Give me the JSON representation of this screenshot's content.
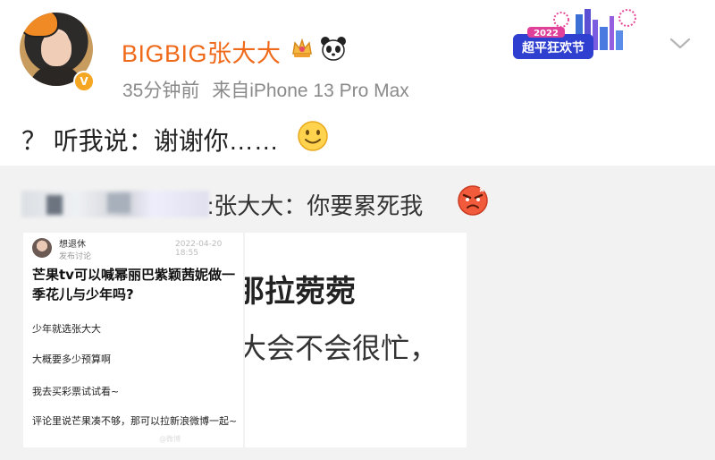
{
  "header": {
    "username": "BIGBIG张大大",
    "time": "35分钟前",
    "source": "来自iPhone 13 Pro Max",
    "promo_year": "2022",
    "promo_text": "超平狂欢节"
  },
  "post": {
    "text": "？ 听我说：谢谢你……"
  },
  "repost": {
    "author_text": ":张大大：你要累死我",
    "image1": {
      "user": "想退休",
      "sub": "发布讨论",
      "time": "2022-04-20 18:55",
      "title": "芒果tv可以喊幂丽巴紫颖茜妮做一季花儿与少年吗?",
      "lines": [
        "少年就选张大大",
        "大概要多少预算啊",
        "我去买彩票试试看~",
        "评论里说芒果凑不够，那可以拉新浪微博一起~"
      ],
      "watermark": "@微博"
    },
    "image2": {
      "line1": "那拉菀菀",
      "line2": "大会不会很忙，"
    }
  },
  "colors": {
    "username": "#f06a1b",
    "meta": "#8a8a8a",
    "repost_bg": "#f2f2f2"
  },
  "icons": [
    "vip-crown-icon",
    "panda-emoji-icon",
    "chevron-down-icon",
    "smile-emoji-icon",
    "angry-emoji-icon",
    "verified-badge-icon"
  ]
}
